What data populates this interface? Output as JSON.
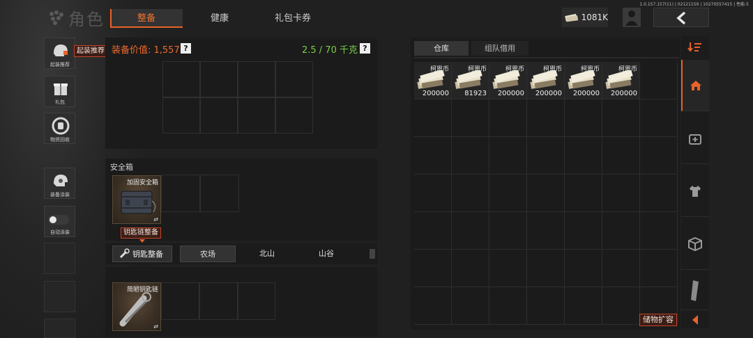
{
  "version": "1.0.157.157(11) | 02121159 | 10270557415 | 性能-5",
  "header": {
    "title": "角色",
    "tabs": [
      {
        "label": "整备",
        "active": true
      },
      {
        "label": "健康",
        "active": false
      },
      {
        "label": "礼包卡券",
        "active": false
      }
    ],
    "currency": "1081K"
  },
  "sidebar": {
    "items": [
      {
        "label": "起装推荐",
        "icon": "helmet-icon"
      },
      {
        "label": "礼包",
        "icon": "gift-icon"
      },
      {
        "label": "物资回收",
        "icon": "recycle-icon"
      },
      {
        "label": "装备涂装",
        "icon": "helmet-paint-icon"
      },
      {
        "label": "自动涂装",
        "icon": "toggle-icon"
      }
    ],
    "recommend_badge": "起装推荐"
  },
  "loadout": {
    "value_label": "装备价值: 1,557",
    "help": "?",
    "weight": "2.5 / 70 千克"
  },
  "safebox": {
    "title": "安全箱",
    "item_name": "加固安全箱",
    "swap": "⇄",
    "badge": "钥匙链整备"
  },
  "keychain": {
    "button_label": "钥匙整备",
    "locations": [
      {
        "label": "农场",
        "active": true
      },
      {
        "label": "北山",
        "active": false
      },
      {
        "label": "山谷",
        "active": false
      }
    ],
    "item_name": "简陋钥匙链",
    "swap": "⇄"
  },
  "warehouse": {
    "tabs": [
      {
        "label": "仓库",
        "active": true
      },
      {
        "label": "组队借用",
        "active": false
      }
    ],
    "items": [
      {
        "name": "柯恩币",
        "count": "200000"
      },
      {
        "name": "柯恩币",
        "count": "81923"
      },
      {
        "name": "柯恩币",
        "count": "200000"
      },
      {
        "name": "柯恩币",
        "count": "200000"
      },
      {
        "name": "柯恩币",
        "count": "200000"
      },
      {
        "name": "柯恩币",
        "count": "200000"
      }
    ],
    "expand_label": "储物扩容"
  },
  "colors": {
    "accent": "#e8622a",
    "weight_green": "#79d147",
    "value_orange": "#ef6a2c"
  }
}
